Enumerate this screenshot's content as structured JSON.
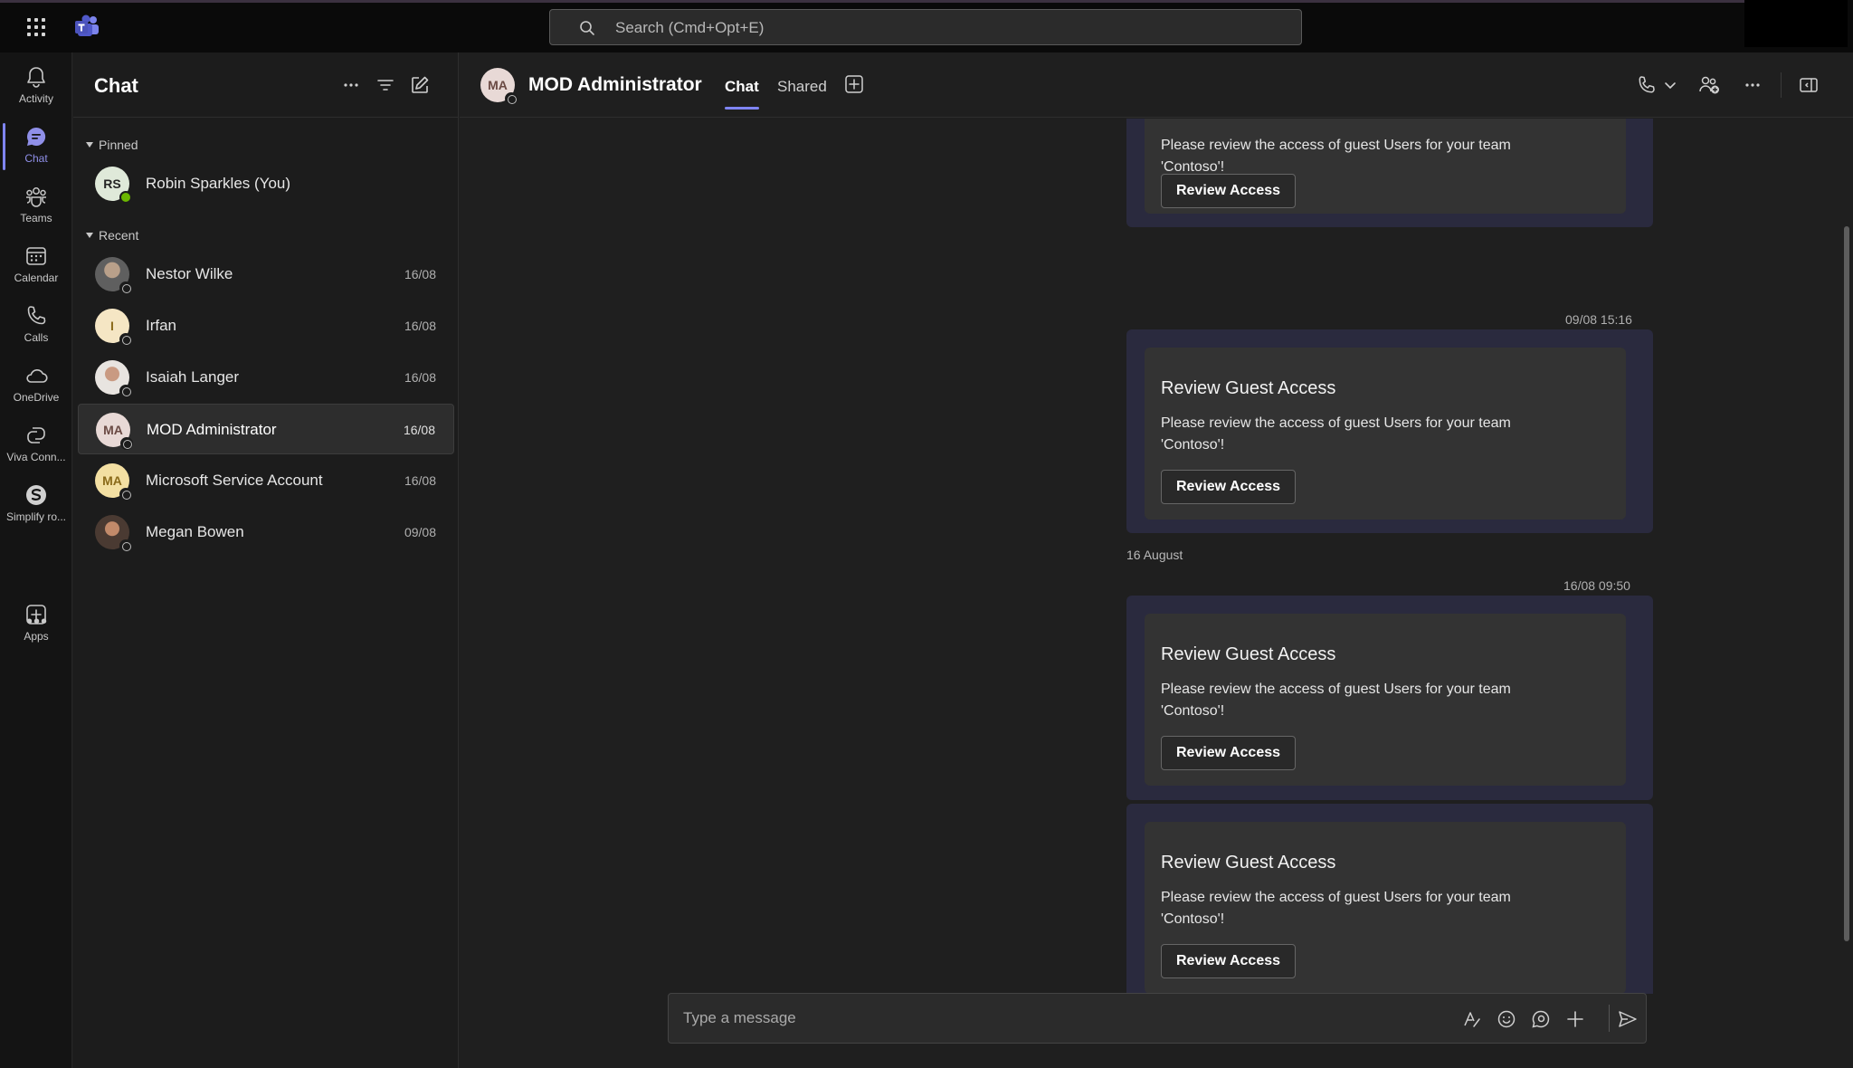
{
  "topbar": {
    "search_placeholder": "Search (Cmd+Opt+E)"
  },
  "rail": {
    "items": [
      {
        "label": "Activity",
        "icon": "bell-icon"
      },
      {
        "label": "Chat",
        "icon": "chat-icon",
        "active": true
      },
      {
        "label": "Teams",
        "icon": "teams-icon"
      },
      {
        "label": "Calendar",
        "icon": "calendar-icon"
      },
      {
        "label": "Calls",
        "icon": "phone-icon"
      },
      {
        "label": "OneDrive",
        "icon": "cloud-icon"
      },
      {
        "label": "Viva Conn...",
        "icon": "viva-icon"
      },
      {
        "label": "Simplify ro...",
        "icon": "simplify-icon"
      },
      {
        "label": "Apps",
        "icon": "plus-square-icon"
      }
    ],
    "more": "•••"
  },
  "chatlist": {
    "title": "Chat",
    "pinned_label": "Pinned",
    "recent_label": "Recent",
    "pinned": [
      {
        "initials": "RS",
        "name": "Robin Sparkles (You)",
        "date": "",
        "avatar_bg": "#dfe9d9",
        "status": "available"
      }
    ],
    "recent": [
      {
        "initials": "",
        "name": "Nestor Wilke",
        "date": "16/08",
        "avatar_bg": "#8a8a8a",
        "status": "offline",
        "photo": true
      },
      {
        "initials": "I",
        "name": "Irfan",
        "date": "16/08",
        "avatar_bg": "#f5e6c4",
        "status": "offline"
      },
      {
        "initials": "",
        "name": "Isaiah Langer",
        "date": "16/08",
        "avatar_bg": "#c9c2bc",
        "status": "offline",
        "photo": true
      },
      {
        "initials": "MA",
        "name": "MOD Administrator",
        "date": "16/08",
        "avatar_bg": "#e8d9d6",
        "status": "offline",
        "selected": true
      },
      {
        "initials": "MA",
        "name": "Microsoft Service Account",
        "date": "16/08",
        "avatar_bg": "#f3dfa2",
        "status": "offline"
      },
      {
        "initials": "",
        "name": "Megan Bowen",
        "date": "09/08",
        "avatar_bg": "#7a5a4a",
        "status": "offline",
        "photo": true
      }
    ]
  },
  "conversation": {
    "initials": "MA",
    "name": "MOD Administrator",
    "tabs": [
      {
        "label": "Chat",
        "active": true
      },
      {
        "label": "Shared",
        "active": false
      }
    ],
    "day_label": "16 August",
    "stamps": [
      "09/08 15:16",
      "16/08 09:50"
    ],
    "card_title": "Review Guest Access",
    "card_body": "Please review the access of guest Users for your team 'Contoso'!",
    "card_button": "Review Access",
    "composer_placeholder": "Type a message"
  },
  "colors": {
    "accent": "#7f85f5",
    "available": "#6bb700",
    "card_group": "#2a2a3e",
    "card": "#333333"
  }
}
